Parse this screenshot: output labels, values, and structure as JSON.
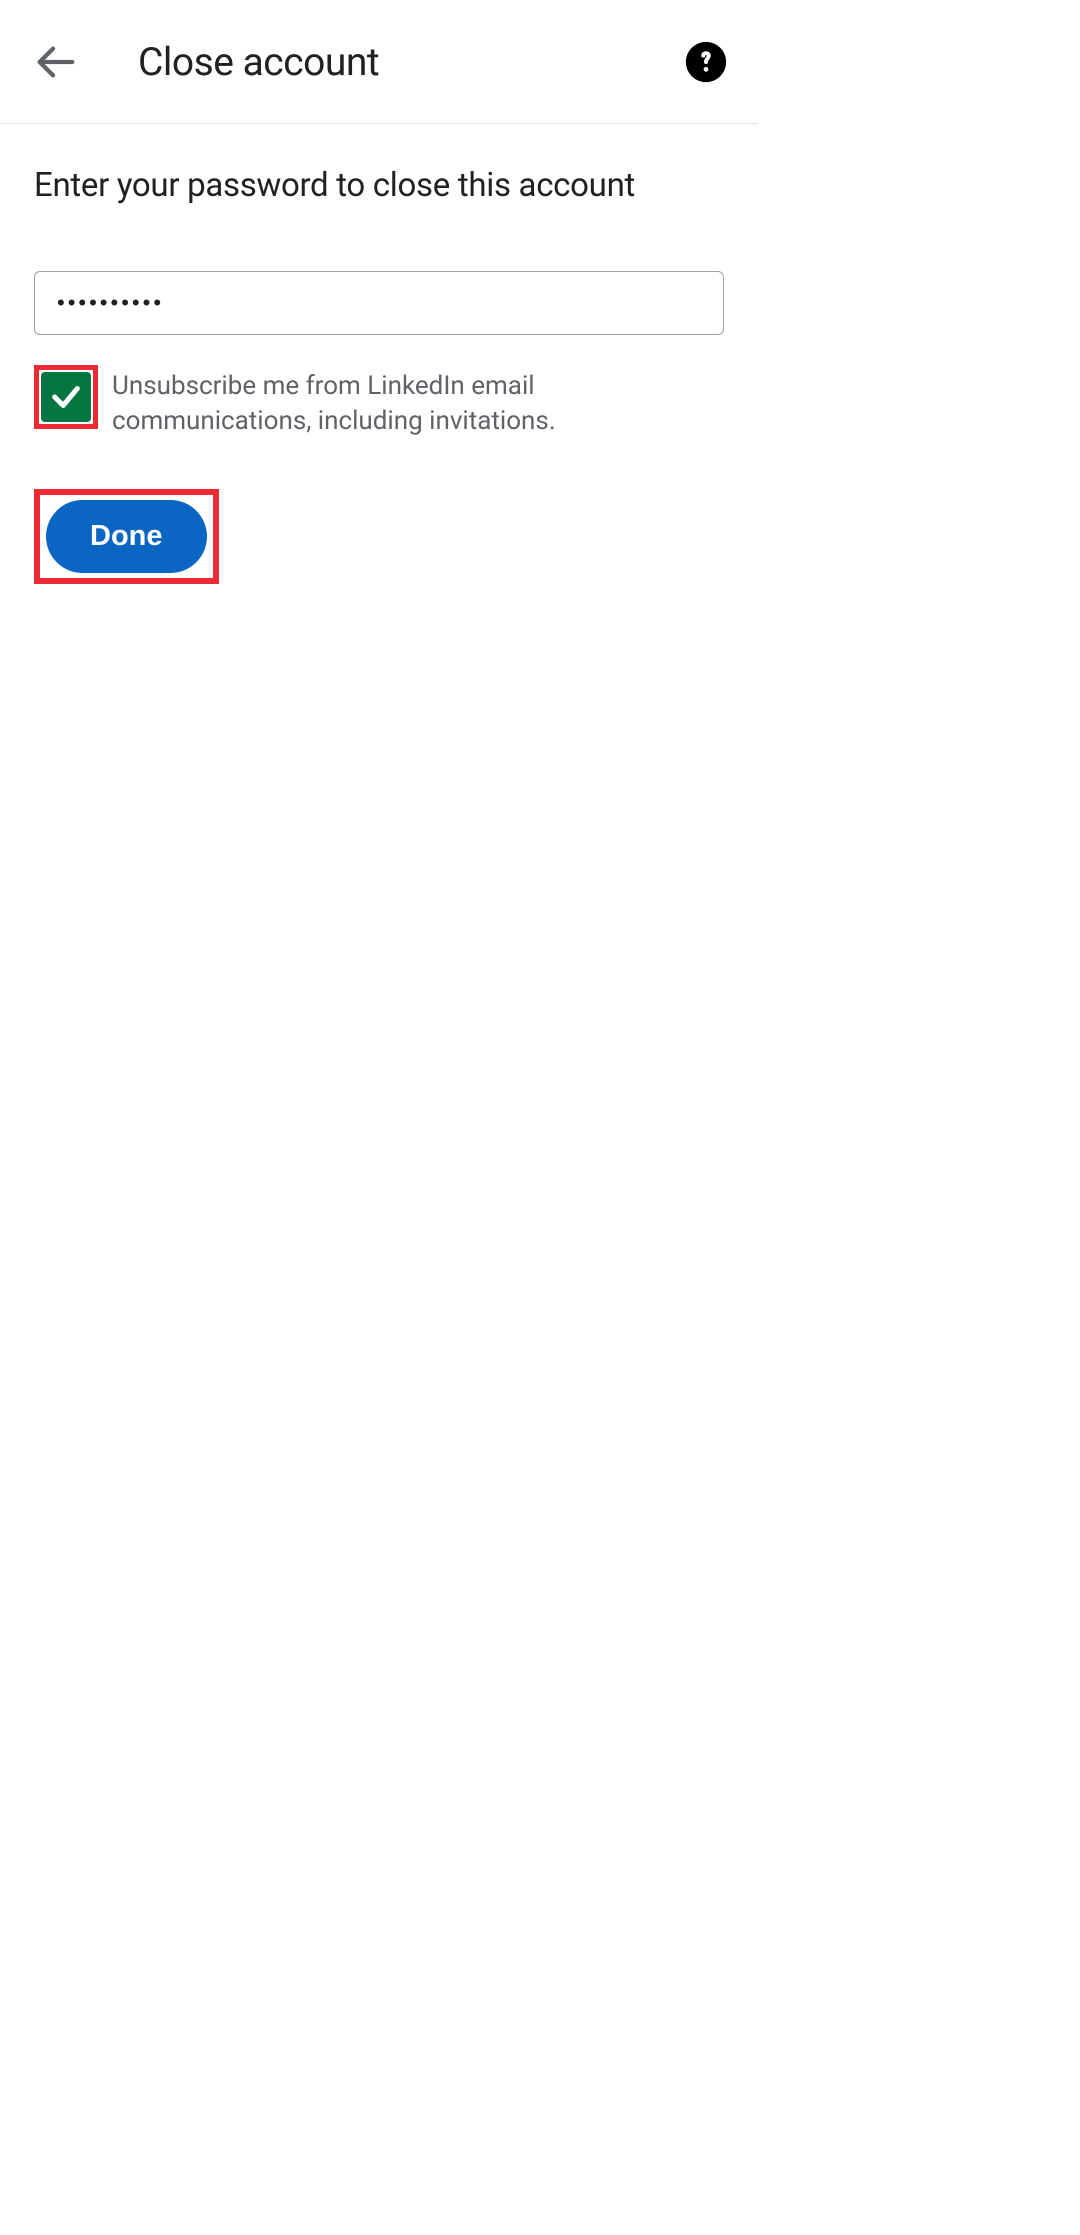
{
  "header": {
    "title": "Close account"
  },
  "content": {
    "subtitle": "Enter your password to close this account",
    "password_value": "••••••••••",
    "checkbox_label": "Unsubscribe me from LinkedIn email communications, including invitations.",
    "done_label": "Done"
  }
}
